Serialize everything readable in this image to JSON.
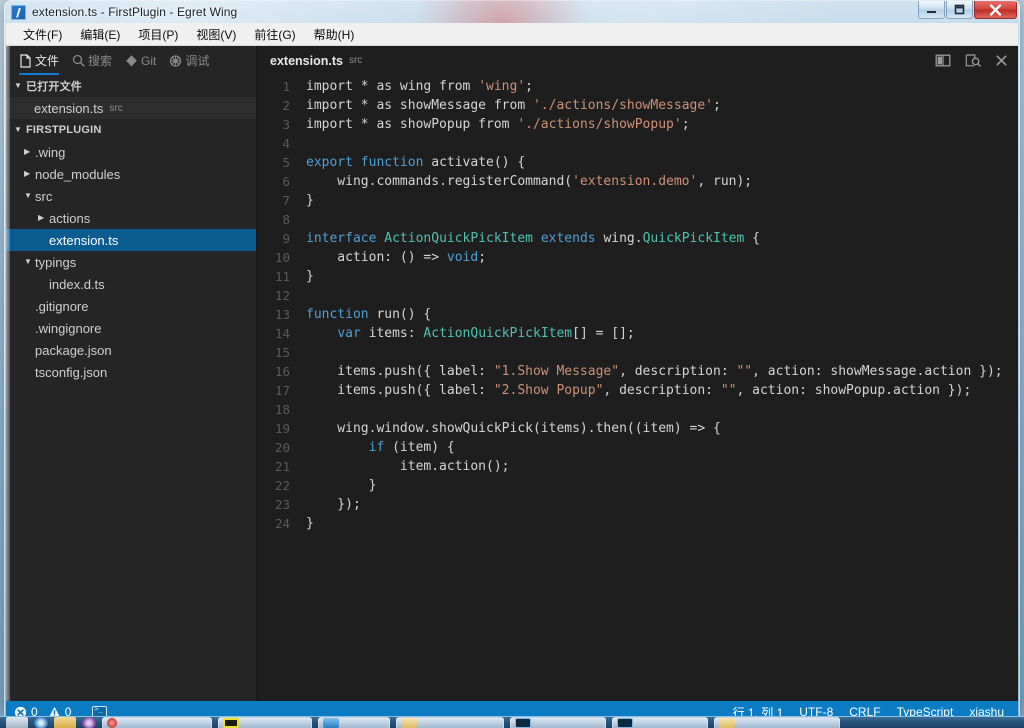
{
  "window": {
    "title": "extension.ts - FirstPlugin - Egret Wing",
    "app_icon": "egret-wing-logo",
    "controls": {
      "minimize": "minimize-icon",
      "maximize": "maximize-icon",
      "close": "close-icon"
    }
  },
  "menubar": {
    "items": [
      {
        "label": "文件(F)",
        "text": "文件",
        "accel": "F"
      },
      {
        "label": "编辑(E)",
        "text": "编辑",
        "accel": "E"
      },
      {
        "label": "项目(P)",
        "text": "项目",
        "accel": "P"
      },
      {
        "label": "视图(V)",
        "text": "视图",
        "accel": "V"
      },
      {
        "label": "前往(G)",
        "text": "前往",
        "accel": "G"
      },
      {
        "label": "帮助(H)",
        "text": "帮助",
        "accel": "H"
      }
    ]
  },
  "sidebar": {
    "tabs": [
      {
        "label": "文件",
        "icon": "file-icon",
        "active": true
      },
      {
        "label": "搜索",
        "icon": "search-icon",
        "active": false
      },
      {
        "label": "Git",
        "icon": "git-branch-icon",
        "active": false
      },
      {
        "label": "调试",
        "icon": "debug-bug-icon",
        "active": false
      }
    ],
    "open_editors": {
      "header": "已打开文件",
      "expanded": true,
      "files": [
        {
          "name": "extension.ts",
          "folder": "src"
        }
      ]
    },
    "project": {
      "header": "FIRSTPLUGIN",
      "expanded": true,
      "tree": [
        {
          "name": ".wing",
          "type": "folder",
          "expanded": false,
          "indent": 1,
          "selected": false
        },
        {
          "name": "node_modules",
          "type": "folder",
          "expanded": false,
          "indent": 1,
          "selected": false
        },
        {
          "name": "src",
          "type": "folder",
          "expanded": true,
          "indent": 1,
          "selected": false
        },
        {
          "name": "actions",
          "type": "folder",
          "expanded": false,
          "indent": 2,
          "selected": false
        },
        {
          "name": "extension.ts",
          "type": "file",
          "expanded": null,
          "indent": 2,
          "selected": true
        },
        {
          "name": "typings",
          "type": "folder",
          "expanded": true,
          "indent": 1,
          "selected": false
        },
        {
          "name": "index.d.ts",
          "type": "file",
          "expanded": null,
          "indent": 2,
          "selected": false
        },
        {
          "name": ".gitignore",
          "type": "file",
          "expanded": null,
          "indent": 1,
          "selected": false
        },
        {
          "name": ".wingignore",
          "type": "file",
          "expanded": null,
          "indent": 1,
          "selected": false
        },
        {
          "name": "package.json",
          "type": "file",
          "expanded": null,
          "indent": 1,
          "selected": false
        },
        {
          "name": "tsconfig.json",
          "type": "file",
          "expanded": null,
          "indent": 1,
          "selected": false
        }
      ]
    }
  },
  "editor": {
    "tab": {
      "title": "extension.ts",
      "subtitle": "src"
    },
    "actions": [
      {
        "name": "split-editor-icon",
        "label": "Split Editor"
      },
      {
        "name": "open-preview-icon",
        "label": "Open Preview"
      },
      {
        "name": "close-editor-icon",
        "label": "Close"
      }
    ],
    "language": "TypeScript",
    "lines": [
      {
        "n": 1,
        "tokens": [
          {
            "t": "import * as wing from ",
            "c": "pl"
          },
          {
            "t": "'wing'",
            "c": "str"
          },
          {
            "t": ";",
            "c": "pl"
          }
        ]
      },
      {
        "n": 2,
        "tokens": [
          {
            "t": "import * as showMessage from ",
            "c": "pl"
          },
          {
            "t": "'./actions/showMessage'",
            "c": "str"
          },
          {
            "t": ";",
            "c": "pl"
          }
        ]
      },
      {
        "n": 3,
        "tokens": [
          {
            "t": "import * as showPopup from ",
            "c": "pl"
          },
          {
            "t": "'./actions/showPopup'",
            "c": "str"
          },
          {
            "t": ";",
            "c": "pl"
          }
        ]
      },
      {
        "n": 4,
        "tokens": []
      },
      {
        "n": 5,
        "tokens": [
          {
            "t": "export",
            "c": "k"
          },
          {
            "t": " ",
            "c": "pl"
          },
          {
            "t": "function",
            "c": "k"
          },
          {
            "t": " activate() {",
            "c": "pl"
          }
        ]
      },
      {
        "n": 6,
        "tokens": [
          {
            "t": "    wing.commands.registerCommand(",
            "c": "pl"
          },
          {
            "t": "'extension.demo'",
            "c": "str"
          },
          {
            "t": ", run);",
            "c": "pl"
          }
        ]
      },
      {
        "n": 7,
        "tokens": [
          {
            "t": "}",
            "c": "pl"
          }
        ]
      },
      {
        "n": 8,
        "tokens": []
      },
      {
        "n": 9,
        "tokens": [
          {
            "t": "interface",
            "c": "k"
          },
          {
            "t": " ",
            "c": "pl"
          },
          {
            "t": "ActionQuickPickItem",
            "c": "typ"
          },
          {
            "t": " ",
            "c": "pl"
          },
          {
            "t": "extends",
            "c": "k"
          },
          {
            "t": " wing.",
            "c": "pl"
          },
          {
            "t": "QuickPickItem",
            "c": "typ"
          },
          {
            "t": " {",
            "c": "pl"
          }
        ]
      },
      {
        "n": 10,
        "tokens": [
          {
            "t": "    action: () => ",
            "c": "pl"
          },
          {
            "t": "void",
            "c": "k"
          },
          {
            "t": ";",
            "c": "pl"
          }
        ]
      },
      {
        "n": 11,
        "tokens": [
          {
            "t": "}",
            "c": "pl"
          }
        ]
      },
      {
        "n": 12,
        "tokens": []
      },
      {
        "n": 13,
        "tokens": [
          {
            "t": "function",
            "c": "k"
          },
          {
            "t": " run() {",
            "c": "pl"
          }
        ]
      },
      {
        "n": 14,
        "tokens": [
          {
            "t": "    ",
            "c": "pl"
          },
          {
            "t": "var",
            "c": "k"
          },
          {
            "t": " items: ",
            "c": "pl"
          },
          {
            "t": "ActionQuickPickItem",
            "c": "typ"
          },
          {
            "t": "[] = [];",
            "c": "pl"
          }
        ]
      },
      {
        "n": 15,
        "tokens": []
      },
      {
        "n": 16,
        "tokens": [
          {
            "t": "    items.push({ label: ",
            "c": "pl"
          },
          {
            "t": "\"1.Show Message\"",
            "c": "str"
          },
          {
            "t": ", description: ",
            "c": "pl"
          },
          {
            "t": "\"\"",
            "c": "str"
          },
          {
            "t": ", action: showMessage.action });",
            "c": "pl"
          }
        ]
      },
      {
        "n": 17,
        "tokens": [
          {
            "t": "    items.push({ label: ",
            "c": "pl"
          },
          {
            "t": "\"2.Show Popup\"",
            "c": "str"
          },
          {
            "t": ", description: ",
            "c": "pl"
          },
          {
            "t": "\"\"",
            "c": "str"
          },
          {
            "t": ", action: showPopup.action });",
            "c": "pl"
          }
        ]
      },
      {
        "n": 18,
        "tokens": []
      },
      {
        "n": 19,
        "tokens": [
          {
            "t": "    wing.window.showQuickPick(items).then((item) => {",
            "c": "pl"
          }
        ]
      },
      {
        "n": 20,
        "tokens": [
          {
            "t": "        ",
            "c": "pl"
          },
          {
            "t": "if",
            "c": "kc"
          },
          {
            "t": " (item) {",
            "c": "pl"
          }
        ]
      },
      {
        "n": 21,
        "tokens": [
          {
            "t": "            item.action();",
            "c": "pl"
          }
        ]
      },
      {
        "n": 22,
        "tokens": [
          {
            "t": "        }",
            "c": "pl"
          }
        ]
      },
      {
        "n": 23,
        "tokens": [
          {
            "t": "    });",
            "c": "pl"
          }
        ]
      },
      {
        "n": 24,
        "tokens": [
          {
            "t": "}",
            "c": "pl"
          }
        ]
      }
    ]
  },
  "statusbar": {
    "errors": "0",
    "warnings": "0",
    "feedback_icon": "console-icon",
    "cursor": "行 1, 列 1",
    "encoding": "UTF-8",
    "eol": "CRLF",
    "language": "TypeScript",
    "user": "xiashu",
    "background": "#0b7cc4"
  },
  "theme": {
    "editor_bg": "#1e1e1e",
    "sidebar_bg": "#252526",
    "selection_blue": "#0b5c91",
    "accent_blue": "#0e7ad4",
    "string_color": "#ce9178",
    "keyword_color": "#4f9fd6",
    "type_color": "#4fc1b0",
    "text_color": "#d4d4d4"
  }
}
